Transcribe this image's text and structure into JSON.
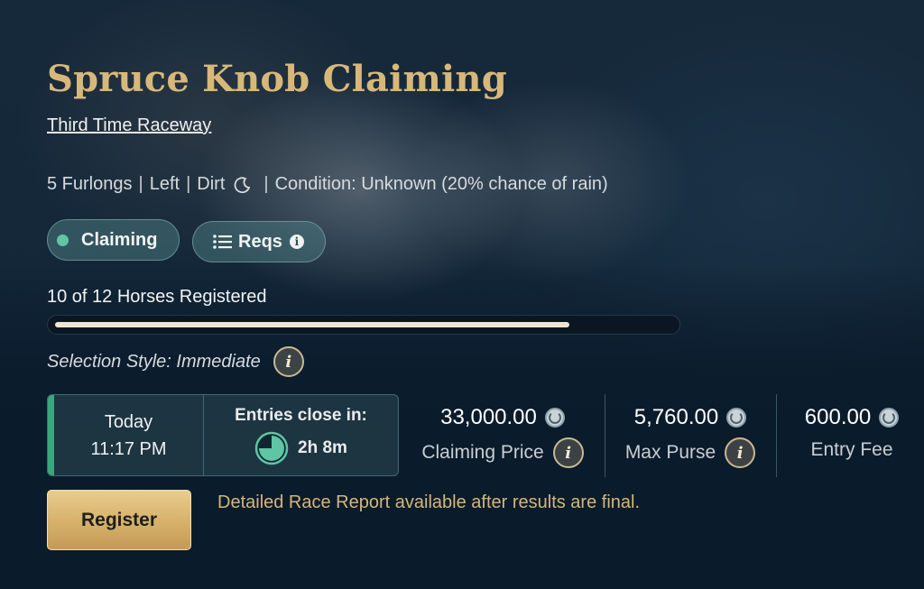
{
  "race": {
    "title": "Spruce Knob Claiming",
    "venue": "Third Time Raceway",
    "distance": "5 Furlongs",
    "direction": "Left",
    "surface": "Dirt",
    "separator": "|",
    "weather_icon": "moon-icon",
    "condition": "Condition: Unknown (20% chance of rain)"
  },
  "tags": {
    "claiming": "Claiming",
    "reqs": "Reqs",
    "reqs_info": "i",
    "status_color": "#5ec6a5"
  },
  "registration": {
    "count_text": "10 of 12 Horses Registered",
    "registered": 10,
    "capacity": 12,
    "selection_style": "Selection Style: Immediate"
  },
  "schedule": {
    "day": "Today",
    "time": "11:17 PM",
    "entries_label": "Entries close in:",
    "countdown": "2h 8m"
  },
  "stats": [
    {
      "value": "33,000.00",
      "label": "Claiming Price",
      "has_info": true
    },
    {
      "value": "5,760.00",
      "label": "Max Purse",
      "has_info": true
    },
    {
      "value": "600.00",
      "label": "Entry Fee",
      "has_info": false
    }
  ],
  "actions": {
    "register_label": "Register",
    "report_note": "Detailed Race Report available after results are final."
  },
  "icons": {
    "info": "i",
    "currency": "horseshoe-coin-icon",
    "list": "list-icon",
    "clock": "pie-clock-icon"
  },
  "colors": {
    "title": "#d8b87a",
    "accent_green": "#3fa57c",
    "gold_button": "#d6b06a",
    "note": "#d6b679"
  }
}
